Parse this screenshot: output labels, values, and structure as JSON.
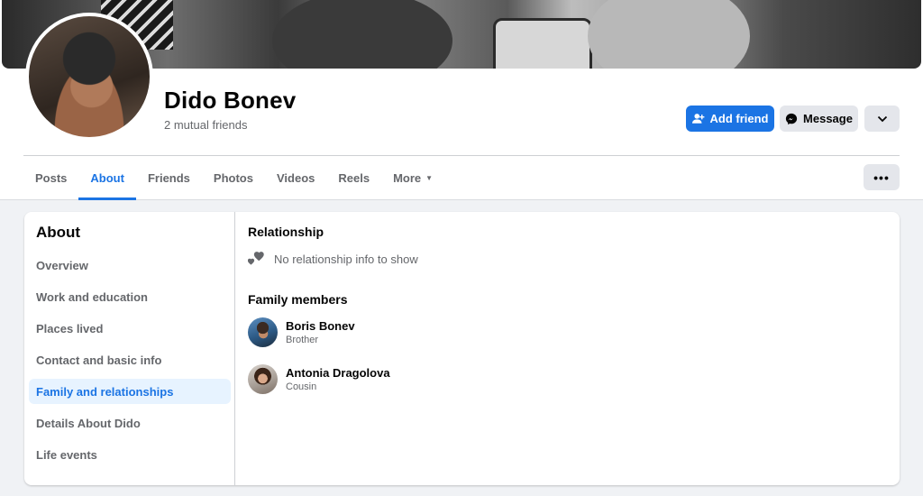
{
  "profile": {
    "name": "Dido Bonev",
    "mutual_friends": "2 mutual friends"
  },
  "actions": {
    "add_friend": "Add friend",
    "message": "Message",
    "more_options_icon": "chevron-down-icon"
  },
  "tabs": [
    {
      "label": "Posts",
      "active": false
    },
    {
      "label": "About",
      "active": true
    },
    {
      "label": "Friends",
      "active": false
    },
    {
      "label": "Photos",
      "active": false
    },
    {
      "label": "Videos",
      "active": false
    },
    {
      "label": "Reels",
      "active": false
    },
    {
      "label": "More",
      "active": false
    }
  ],
  "tabs_overflow": "•••",
  "about": {
    "title": "About",
    "nav": [
      {
        "label": "Overview",
        "active": false
      },
      {
        "label": "Work and education",
        "active": false
      },
      {
        "label": "Places lived",
        "active": false
      },
      {
        "label": "Contact and basic info",
        "active": false
      },
      {
        "label": "Family and relationships",
        "active": true
      },
      {
        "label": "Details About Dido",
        "active": false
      },
      {
        "label": "Life events",
        "active": false
      }
    ]
  },
  "content": {
    "relationship_title": "Relationship",
    "relationship_empty": "No relationship info to show",
    "family_title": "Family members",
    "members": [
      {
        "name": "Boris Bonev",
        "relation": "Brother"
      },
      {
        "name": "Antonia Dragolova",
        "relation": "Cousin"
      }
    ]
  },
  "colors": {
    "accent": "#1b74e4",
    "active_bg": "#e7f3ff",
    "secondary_text": "#65676b",
    "page_bg": "#f0f2f5"
  }
}
